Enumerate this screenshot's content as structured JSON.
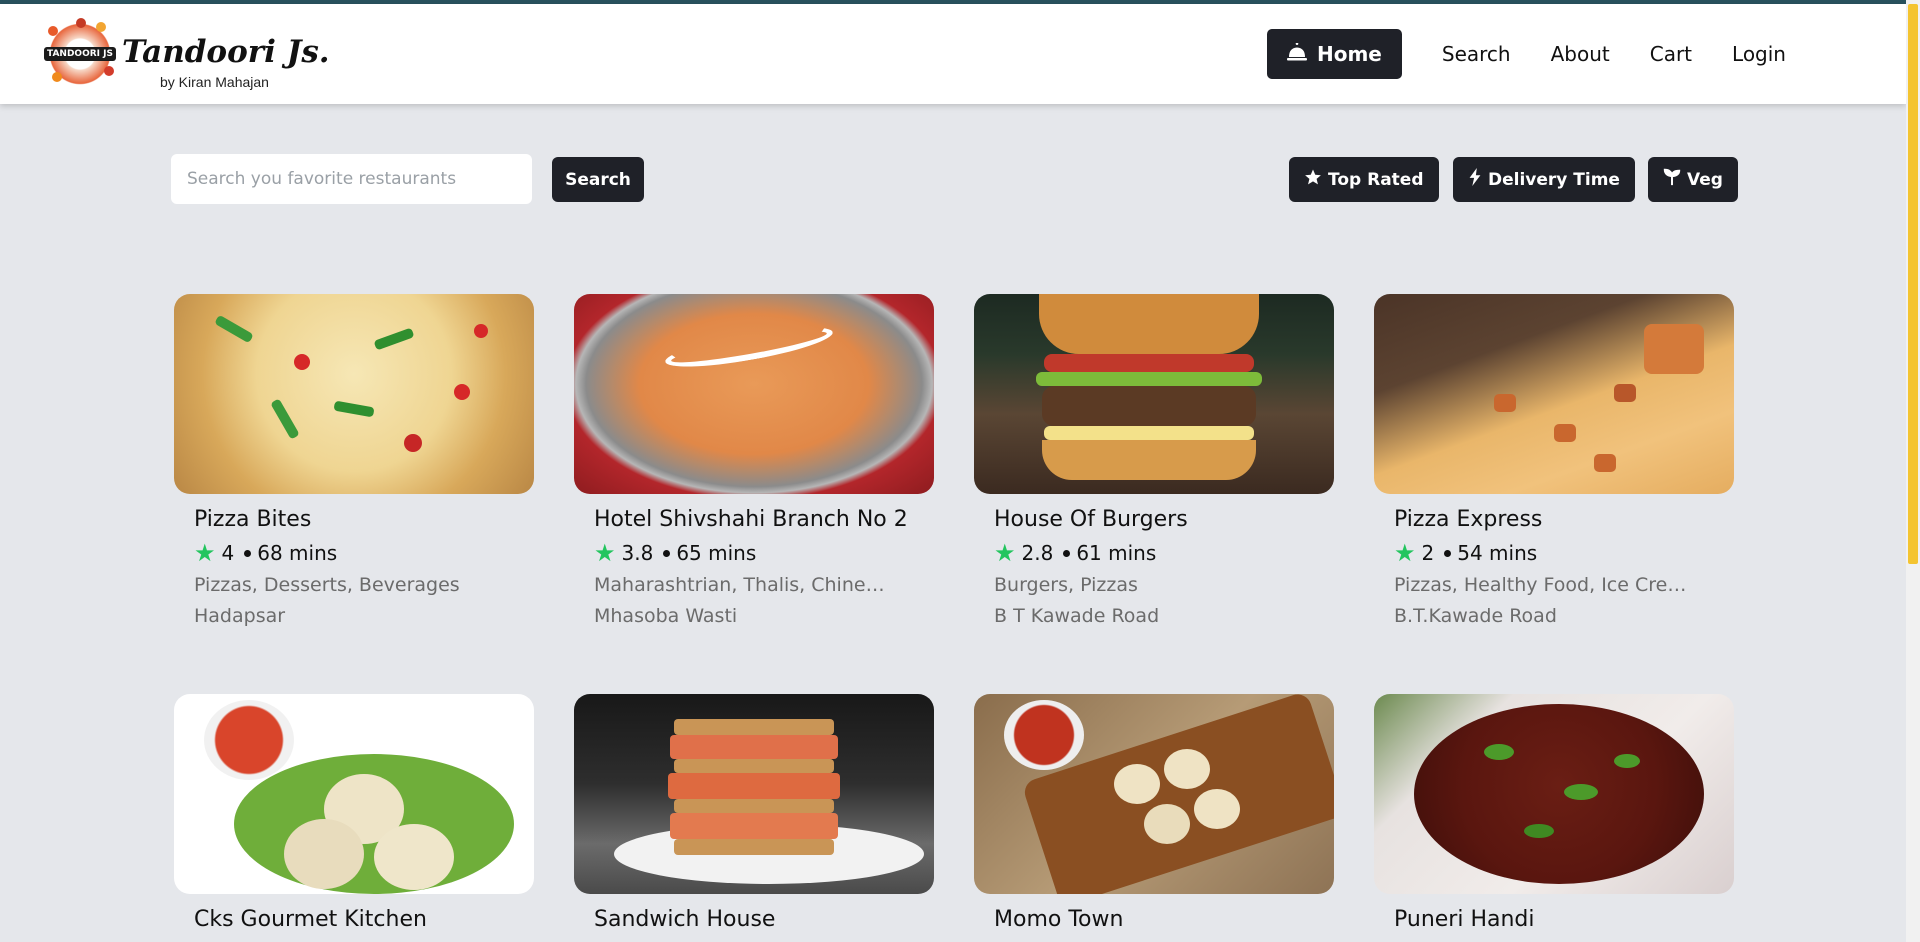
{
  "brand": {
    "logo_badge_text": "TANDOORI JS",
    "title": "Tandoori Js.",
    "subtitle": "by Kiran Mahajan"
  },
  "nav": {
    "home_label": "Home",
    "links": [
      "Search",
      "About",
      "Cart",
      "Login"
    ]
  },
  "search": {
    "placeholder": "Search you favorite restaurants",
    "value": "",
    "button_label": "Search"
  },
  "filters": {
    "top_rated": "Top Rated",
    "delivery_time": "Delivery Time",
    "veg": "Veg"
  },
  "colors": {
    "accent_dark": "#1f2128",
    "rating_star": "#22c55e",
    "page_bg": "#e5e7eb"
  },
  "restaurants": [
    {
      "name": "Pizza Bites",
      "rating": "4",
      "time": "68 mins",
      "cuisines": "Pizzas, Desserts, Beverages",
      "area": "Hadapsar"
    },
    {
      "name": "Hotel Shivshahi Branch No 2",
      "rating": "3.8",
      "time": "65 mins",
      "cuisines": "Maharashtrian, Thalis, Chinese, North Indian",
      "area": "Mhasoba Wasti"
    },
    {
      "name": "House Of Burgers",
      "rating": "2.8",
      "time": "61 mins",
      "cuisines": "Burgers, Pizzas",
      "area": "B T Kawade Road"
    },
    {
      "name": "Pizza Express",
      "rating": "2",
      "time": "54 mins",
      "cuisines": "Pizzas, Healthy Food, Ice Cream",
      "area": "B.T.Kawade Road"
    },
    {
      "name": "Cks Gourmet Kitchen"
    },
    {
      "name": "Sandwich House"
    },
    {
      "name": "Momo Town"
    },
    {
      "name": "Puneri Handi"
    }
  ]
}
